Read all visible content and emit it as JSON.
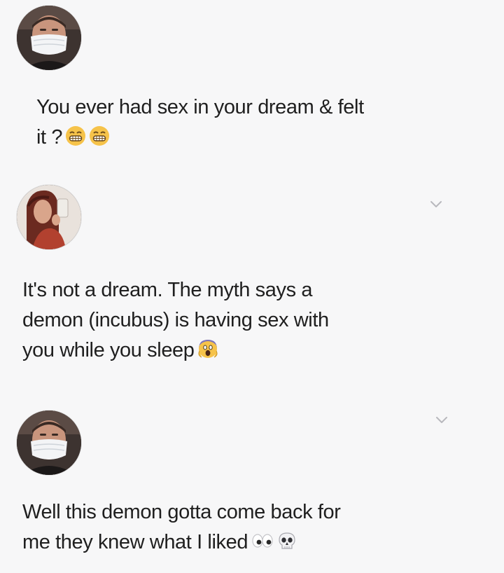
{
  "tweets": [
    {
      "avatar_icon": "masked-man-avatar",
      "text": "You ever had sex in your dream & felt\nit ?",
      "emojis": [
        "grimacing-face-emoji",
        "grimacing-face-emoji"
      ],
      "has_more_chevron": false
    },
    {
      "avatar_icon": "woman-selfie-avatar",
      "text": "It's not a dream. The myth says a\ndemon (incubus) is having sex with\nyou while you sleep",
      "emojis": [
        "screaming-face-emoji"
      ],
      "has_more_chevron": true
    },
    {
      "avatar_icon": "masked-man-avatar",
      "text": "Well this demon gotta come back for\nme they knew what I liked",
      "emojis": [
        "eyes-emoji",
        "skull-emoji"
      ],
      "has_more_chevron": true
    }
  ],
  "colors": {
    "background": "#f7f7f8",
    "text": "#1f1f1f",
    "chevron": "#b8b8bd"
  }
}
